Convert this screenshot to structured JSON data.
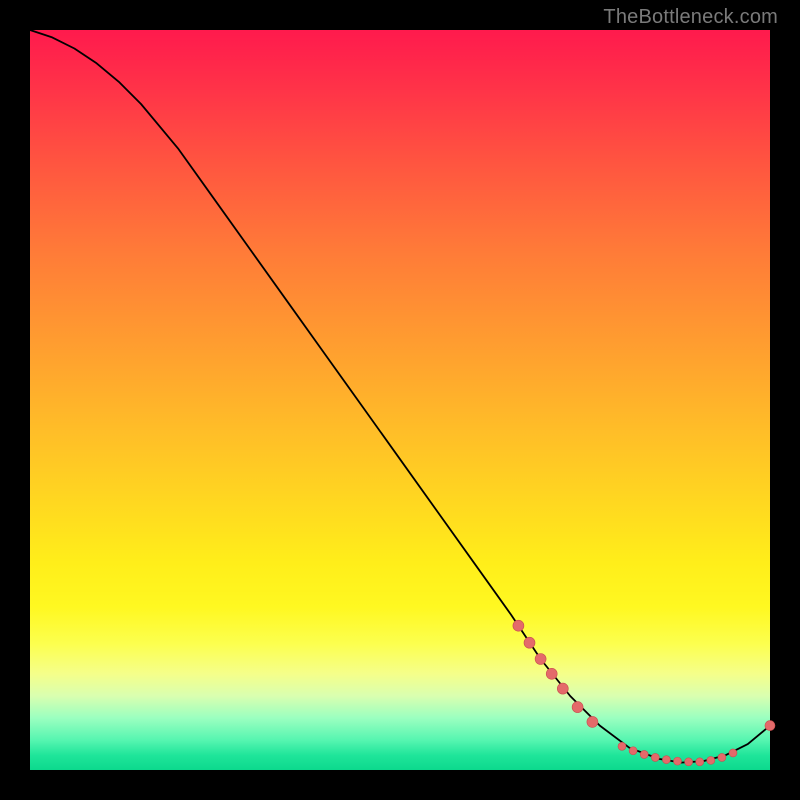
{
  "watermark": "TheBottleneck.com",
  "colors": {
    "bg": "#000000",
    "curve": "#000000",
    "marker_fill": "#e46a6a",
    "marker_stroke": "#c94f4f",
    "gradient_top": "#ff1a4d",
    "gradient_bottom": "#0cd98d"
  },
  "chart_data": {
    "type": "line",
    "title": "",
    "xlabel": "",
    "ylabel": "",
    "xlim": [
      0,
      100
    ],
    "ylim": [
      0,
      100
    ],
    "grid": false,
    "legend": false,
    "annotations": [],
    "curve": [
      {
        "x": 0,
        "y": 100
      },
      {
        "x": 3,
        "y": 99
      },
      {
        "x": 6,
        "y": 97.5
      },
      {
        "x": 9,
        "y": 95.5
      },
      {
        "x": 12,
        "y": 93
      },
      {
        "x": 15,
        "y": 90
      },
      {
        "x": 20,
        "y": 84
      },
      {
        "x": 25,
        "y": 77
      },
      {
        "x": 30,
        "y": 70
      },
      {
        "x": 35,
        "y": 63
      },
      {
        "x": 40,
        "y": 56
      },
      {
        "x": 45,
        "y": 49
      },
      {
        "x": 50,
        "y": 42
      },
      {
        "x": 55,
        "y": 35
      },
      {
        "x": 60,
        "y": 28
      },
      {
        "x": 65,
        "y": 21
      },
      {
        "x": 69,
        "y": 15
      },
      {
        "x": 73,
        "y": 10
      },
      {
        "x": 77,
        "y": 6
      },
      {
        "x": 81,
        "y": 3
      },
      {
        "x": 85,
        "y": 1.5
      },
      {
        "x": 88,
        "y": 1
      },
      {
        "x": 91,
        "y": 1.2
      },
      {
        "x": 94,
        "y": 2
      },
      {
        "x": 97,
        "y": 3.5
      },
      {
        "x": 100,
        "y": 6
      }
    ],
    "markers": [
      {
        "x": 66,
        "y": 19.5,
        "r": 5.5
      },
      {
        "x": 67.5,
        "y": 17.2,
        "r": 5.5
      },
      {
        "x": 69,
        "y": 15.0,
        "r": 5.5
      },
      {
        "x": 70.5,
        "y": 13.0,
        "r": 5.5
      },
      {
        "x": 72,
        "y": 11.0,
        "r": 5.5
      },
      {
        "x": 74,
        "y": 8.5,
        "r": 5.5
      },
      {
        "x": 76,
        "y": 6.5,
        "r": 5.5
      },
      {
        "x": 80,
        "y": 3.2,
        "r": 4.0
      },
      {
        "x": 81.5,
        "y": 2.6,
        "r": 4.0
      },
      {
        "x": 83,
        "y": 2.1,
        "r": 4.0
      },
      {
        "x": 84.5,
        "y": 1.7,
        "r": 4.0
      },
      {
        "x": 86,
        "y": 1.4,
        "r": 4.0
      },
      {
        "x": 87.5,
        "y": 1.2,
        "r": 4.0
      },
      {
        "x": 89,
        "y": 1.1,
        "r": 4.0
      },
      {
        "x": 90.5,
        "y": 1.1,
        "r": 4.0
      },
      {
        "x": 92,
        "y": 1.3,
        "r": 4.0
      },
      {
        "x": 93.5,
        "y": 1.7,
        "r": 4.0
      },
      {
        "x": 95,
        "y": 2.3,
        "r": 4.0
      },
      {
        "x": 100,
        "y": 6.0,
        "r": 5.0
      }
    ]
  }
}
